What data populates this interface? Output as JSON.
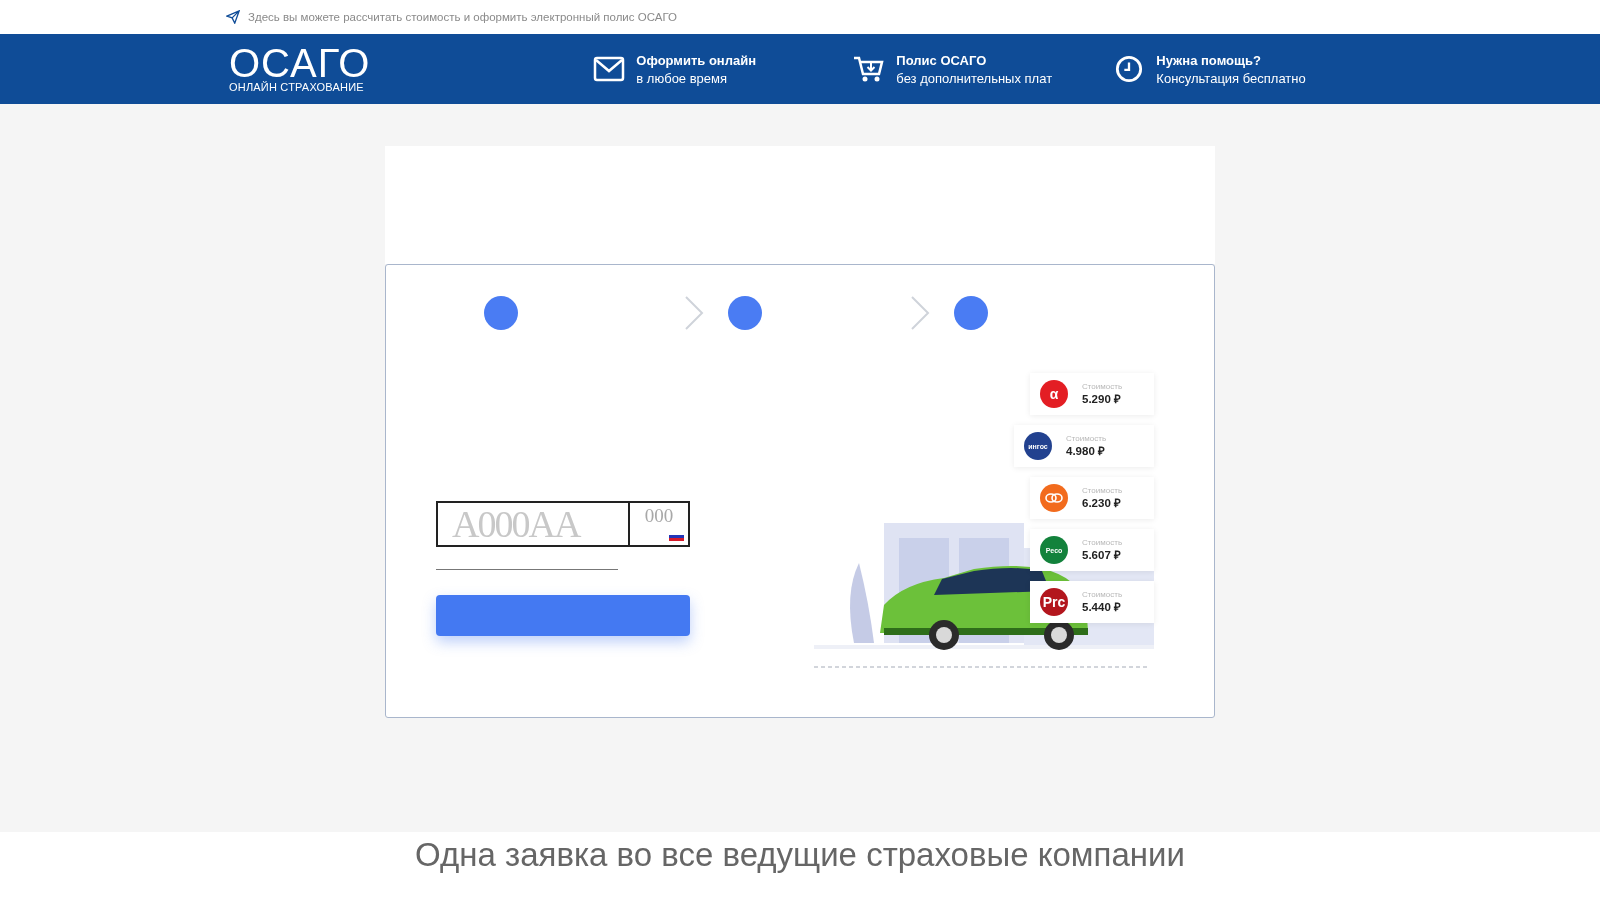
{
  "top_bar": {
    "text": "Здесь вы можете рассчитать стоимость и оформить электронный полис ОСАГО"
  },
  "logo": {
    "title": "ОСАГО",
    "subtitle": "ОНЛАЙН СТРАХОВАНИЕ"
  },
  "header_features": [
    {
      "kind": "mail",
      "title": "Оформить онлайн",
      "subtitle": "в любое время"
    },
    {
      "kind": "cart",
      "title": "Полис ОСАГО",
      "subtitle": "без дополнительных плат"
    },
    {
      "kind": "clock",
      "title": "Нужна помощь?",
      "subtitle": "Консультация бесплатно"
    }
  ],
  "plate": {
    "number_placeholder": "А000АА",
    "region_placeholder": "000"
  },
  "quotes": [
    {
      "logo": "α",
      "color": "#e31e24",
      "label": "Стоимость",
      "price": "5.290 ₽"
    },
    {
      "logo": "ингос",
      "color": "#22418f",
      "label": "Стоимость",
      "price": "4.980 ₽"
    },
    {
      "color": "#f26b1d",
      "label": "Стоимость",
      "price": "6.230 ₽"
    },
    {
      "logo": "Peco",
      "color": "#13823c",
      "label": "Стоимость",
      "price": "5.607 ₽"
    },
    {
      "logo": "Prc",
      "color": "#b3161d",
      "label": "Стоимость",
      "price": "5.440 ₽"
    }
  ],
  "bottom_heading": "Одна заявка во все ведущие страховые компании"
}
